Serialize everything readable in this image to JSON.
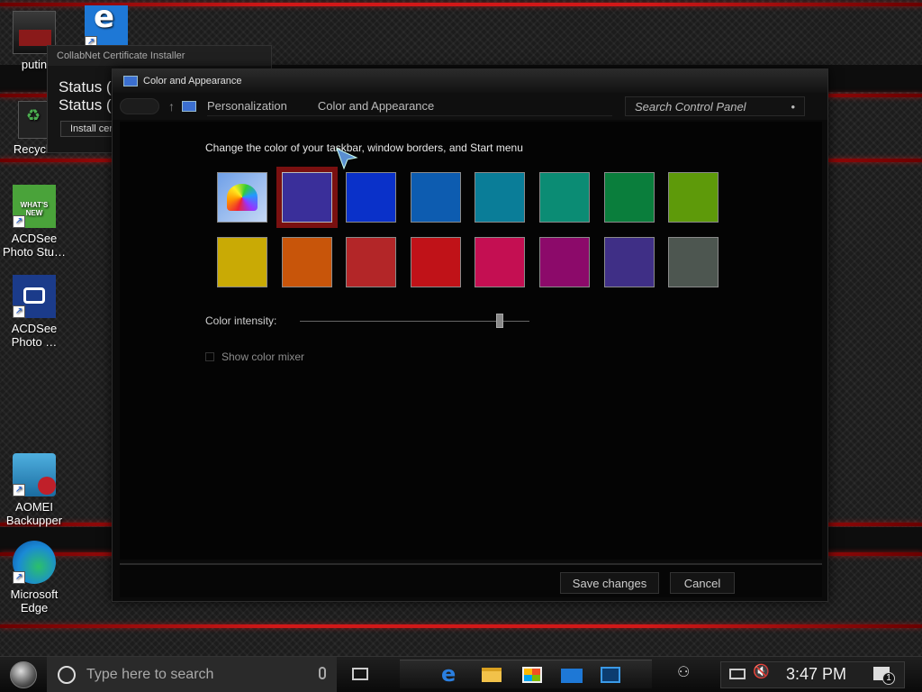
{
  "desktop": {
    "icons": [
      {
        "label": "putin",
        "icon": "app-icon"
      },
      {
        "label": "Recycle",
        "icon": "recycle-bin-icon"
      },
      {
        "label": "ACDSee Photo Stu…",
        "icon": "acdsee-whats-new-icon",
        "badge": "WHAT'S NEW"
      },
      {
        "label": "ACDSee Photo …",
        "icon": "acdsee-camera-icon"
      },
      {
        "label": "AOMEI Backupper",
        "icon": "aomei-icon"
      },
      {
        "label": "Microsoft Edge",
        "icon": "edge-icon"
      }
    ]
  },
  "bg_window": {
    "title": "CollabNet Certificate Installer",
    "status1": "Status (",
    "status2": "Status (s",
    "button": "Install cer"
  },
  "window": {
    "title": "Color and Appearance",
    "breadcrumb": [
      "Personalization",
      "Color and Appearance"
    ],
    "search_placeholder": "Search Control Panel",
    "heading": "Change the color of your taskbar, window borders, and Start menu",
    "swatches_row1": [
      "rainbow",
      "#3a2f9a",
      "#0a31c9",
      "#0d5cb0",
      "#0a7d98",
      "#0b8c74",
      "#0a7e3c",
      "#5e9a0a"
    ],
    "swatches_row2": [
      "#c9aa05",
      "#c8550a",
      "#b32628",
      "#c01218",
      "#c40f52",
      "#8c0a6a",
      "#3f2f86",
      "#4d5650"
    ],
    "selected_index": 1,
    "intensity_label": "Color intensity:",
    "intensity_value": 0.87,
    "mixer_label": "Show color mixer",
    "save": "Save changes",
    "cancel": "Cancel"
  },
  "taskbar": {
    "search_placeholder": "Type here to search",
    "time": "3:47 PM",
    "notification_count": "1"
  }
}
